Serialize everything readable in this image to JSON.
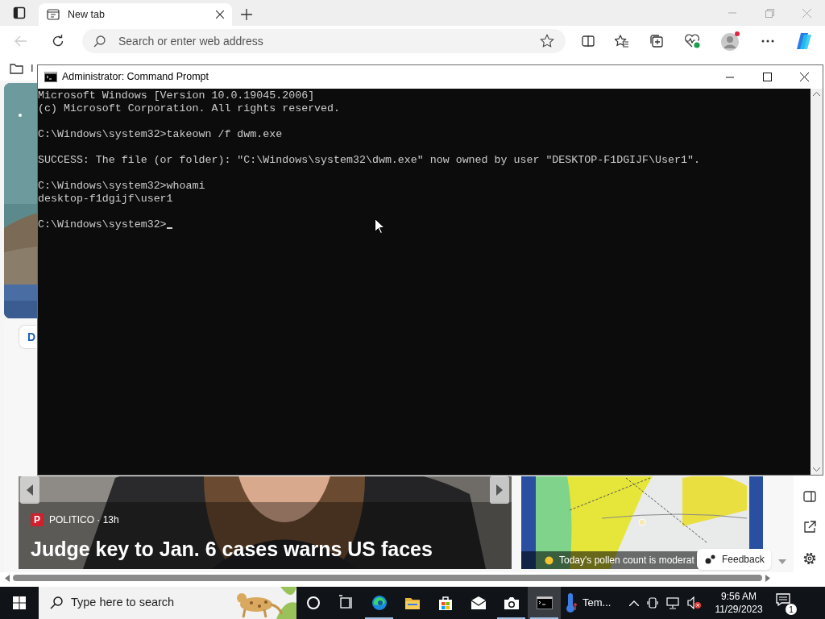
{
  "browser": {
    "tabs": [
      {
        "title": "New tab",
        "selected": true
      }
    ],
    "address_bar": {
      "placeholder": "Search or enter web address"
    },
    "favorites_bar": {
      "item": "I"
    }
  },
  "page": {
    "chip": "D",
    "news_card": {
      "source_logo": "P",
      "source": "POLITICO · 13h",
      "headline": "Judge key to Jan. 6 cases warns US faces"
    },
    "weather_card": {
      "caption": "Today's pollen count is moderat"
    },
    "feedback_button": "Feedback"
  },
  "cmd": {
    "title": "Administrator: Command Prompt",
    "blocks": [
      {
        "lines": [
          {
            "text": "Microsoft Windows [Version 10.0.19045.2006]",
            "cursor": false
          },
          {
            "text": "(c) Microsoft Corporation. All rights reserved.",
            "cursor": false
          }
        ]
      },
      {
        "lines": [
          {
            "text": "C:\\Windows\\system32>takeown /f dwm.exe",
            "cursor": false
          }
        ]
      },
      {
        "lines": [
          {
            "text": "SUCCESS: The file (or folder): \"C:\\Windows\\system32\\dwm.exe\" now owned by user \"DESKTOP-F1DGIJF\\User1\".",
            "cursor": false
          }
        ]
      },
      {
        "lines": [
          {
            "text": "C:\\Windows\\system32>whoami",
            "cursor": false
          },
          {
            "text": "desktop-f1dgijf\\user1",
            "cursor": false
          }
        ]
      },
      {
        "lines": [
          {
            "text": "C:\\Windows\\system32>",
            "cursor": true
          }
        ]
      }
    ]
  },
  "taskbar": {
    "search_placeholder": "Type here to search",
    "apps": [
      {
        "kind": "cortana",
        "running": false,
        "active": false
      },
      {
        "kind": "taskview",
        "running": false,
        "active": false
      },
      {
        "kind": "edge",
        "running": true,
        "active": false
      },
      {
        "kind": "explorer",
        "running": false,
        "active": false
      },
      {
        "kind": "store",
        "running": false,
        "active": false
      },
      {
        "kind": "mail",
        "running": false,
        "active": false
      },
      {
        "kind": "camera",
        "running": true,
        "active": false
      },
      {
        "kind": "cmd",
        "running": true,
        "active": true
      }
    ],
    "weather": "Tem...",
    "time": "9:56 AM",
    "date": "11/29/2023",
    "notification_count": "1"
  }
}
